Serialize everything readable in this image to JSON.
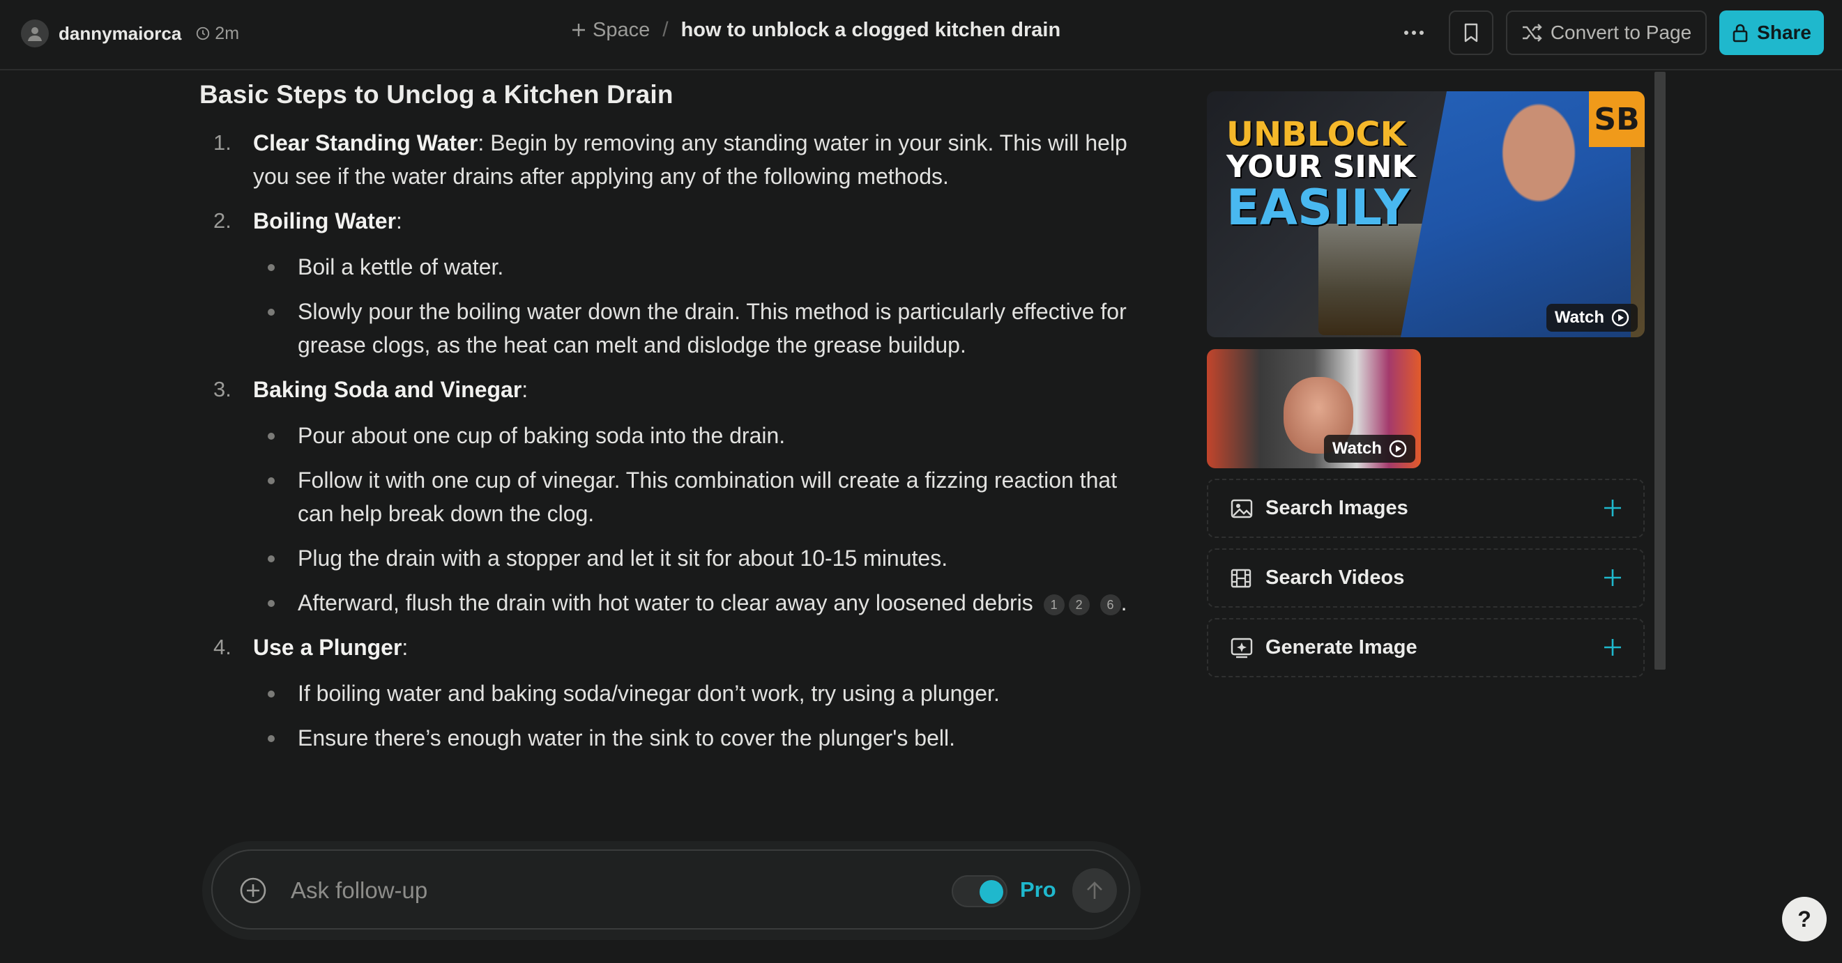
{
  "header": {
    "username": "dannymaiorca",
    "time_ago": "2m",
    "space_label": "Space",
    "breadcrumb_sep": "/",
    "thread_title": "how to unblock a clogged kitchen drain",
    "convert_label": "Convert to Page",
    "share_label": "Share"
  },
  "answer": {
    "heading": "Basic Steps to Unclog a Kitchen Drain",
    "steps": [
      {
        "num": "1.",
        "title": "Clear Standing Water",
        "text": ": Begin by removing any standing water in your sink. This will help you see if the water drains after applying any of the following methods."
      },
      {
        "num": "2.",
        "title": "Boiling Water",
        "text": ":",
        "bullets": [
          "Boil a kettle of water.",
          "Slowly pour the boiling water down the drain. This method is particularly effective for grease clogs, as the heat can melt and dislodge the grease buildup."
        ]
      },
      {
        "num": "3.",
        "title": "Baking Soda and Vinegar",
        "text": ":",
        "bullets": [
          "Pour about one cup of baking soda into the drain.",
          "Follow it with one cup of vinegar. This combination will create a fizzing reaction that can help break down the clog.",
          "Plug the drain with a stopper and let it sit for about 10-15 minutes.",
          "Afterward, flush the drain with hot water to clear away any loosened debris"
        ],
        "citations": [
          "1",
          "2",
          "6"
        ],
        "trailing": "."
      },
      {
        "num": "4.",
        "title": "Use a Plunger",
        "text": ":",
        "bullets": [
          "If boiling water and baking soda/vinegar don’t work, try using a plunger.",
          "Ensure there’s enough water in the sink to cover the plunger's bell."
        ]
      }
    ]
  },
  "sidebar": {
    "video_main": {
      "line1": "UNBLOCK",
      "line2": "YOUR SINK",
      "line3": "EASILY",
      "badge": "SB",
      "watch_label": "Watch"
    },
    "video_small": {
      "watch_label": "Watch"
    },
    "tools": [
      {
        "label": "Search Images",
        "icon": "image-icon"
      },
      {
        "label": "Search Videos",
        "icon": "film-icon"
      },
      {
        "label": "Generate Image",
        "icon": "sparkle-image-icon"
      }
    ]
  },
  "composer": {
    "placeholder": "Ask follow-up",
    "pro_label": "Pro",
    "pro_enabled": true
  },
  "help_label": "?",
  "colors": {
    "accent": "#1fb8cd",
    "background": "#191a1a",
    "text": "#e8e8e6"
  }
}
